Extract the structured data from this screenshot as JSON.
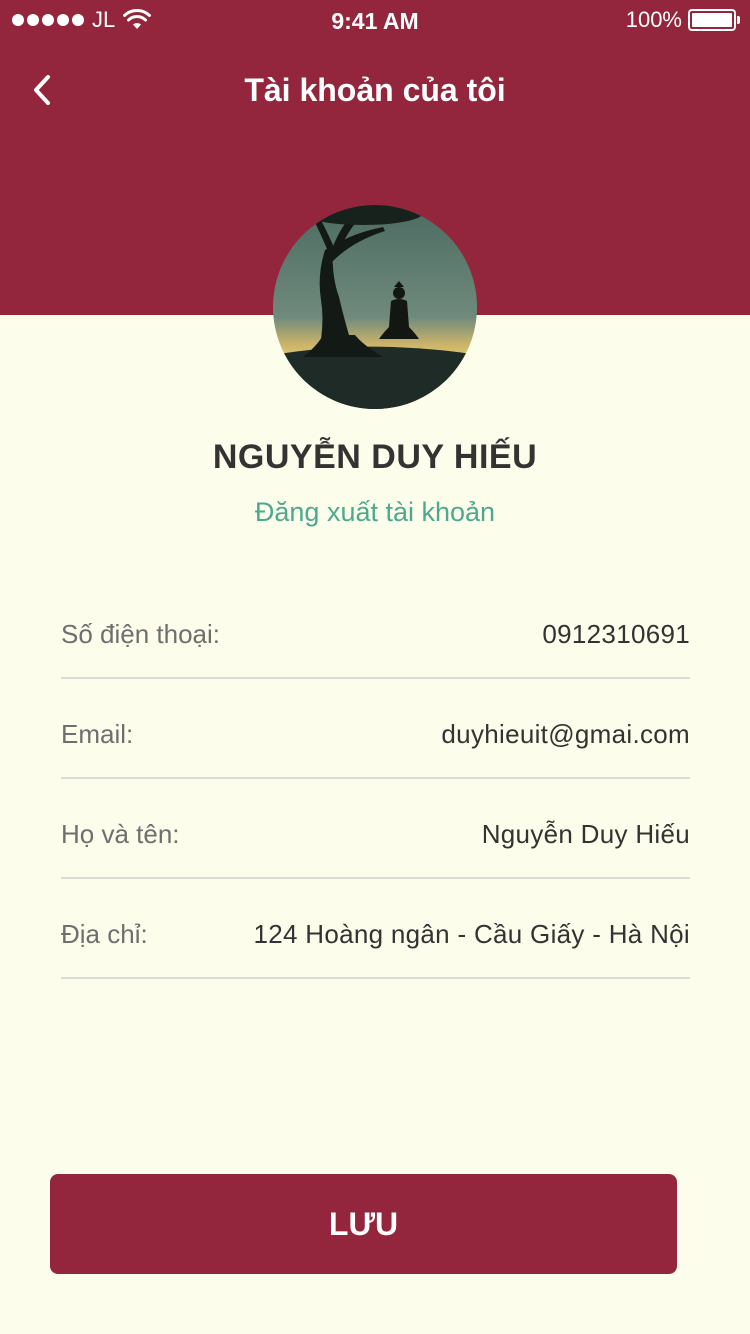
{
  "status_bar": {
    "carrier": "JL",
    "time": "9:41 AM",
    "battery": "100%",
    "signal_icon": "signal-dots-icon",
    "wifi_icon": "wifi-icon",
    "battery_icon": "battery-full-icon"
  },
  "nav": {
    "title": "Tài khoản của tôi",
    "back_icon": "chevron-left-icon"
  },
  "profile": {
    "name": "NGUYỄN DUY HIẾU",
    "logout_label": "Đăng xuất tài khoản"
  },
  "info": [
    {
      "label": "Số điện thoại:",
      "value": "0912310691"
    },
    {
      "label": "Email:",
      "value": "duyhieuit@gmai.com"
    },
    {
      "label": "Họ và tên:",
      "value": "Nguyễn Duy Hiếu"
    },
    {
      "label": "Địa chỉ:",
      "value": "124 Hoàng ngân - Cầu Giấy - Hà Nội"
    }
  ],
  "actions": {
    "save_label": "LƯU"
  },
  "colors": {
    "primary": "#93263d",
    "background": "#fdfdec",
    "link": "#4ca98f",
    "label_text": "#6f6f6f",
    "value_text": "#333333",
    "divider": "#dcdcd6"
  }
}
